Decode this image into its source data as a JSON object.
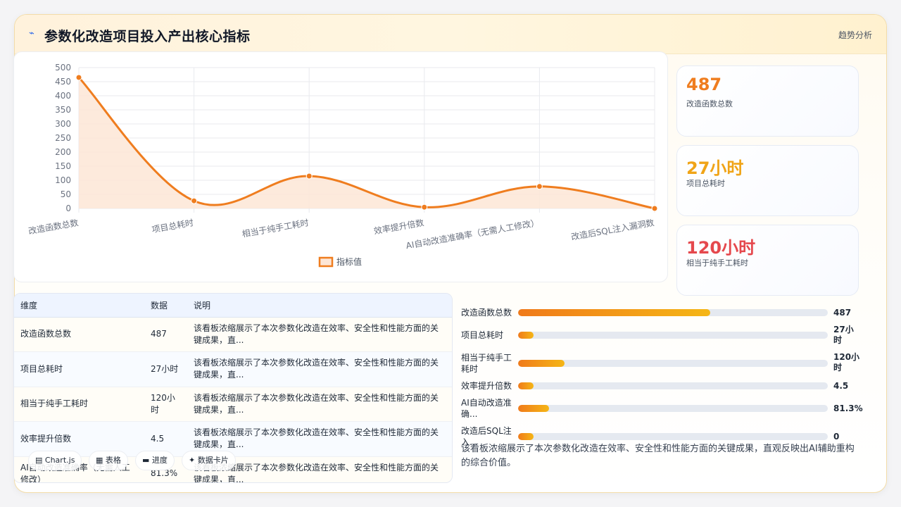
{
  "header": {
    "title": "参数化改造项目投入产出核心指标",
    "trend_label": "趋势分析",
    "icon": "lightning-icon"
  },
  "chart_data": {
    "type": "line",
    "categories": [
      "改造函数总数",
      "项目总耗时",
      "相当于纯手工耗时",
      "效率提升倍数",
      "AI自动改造准确率（无需人工修改）",
      "改造后SQL注入漏洞数"
    ],
    "series": [
      {
        "name": "指标值",
        "values": [
          465,
          27,
          115,
          4.5,
          78,
          0
        ]
      }
    ],
    "ylim": [
      0,
      500
    ],
    "yticks": [
      0,
      50,
      100,
      150,
      200,
      250,
      300,
      350,
      400,
      450,
      500
    ],
    "grid": true,
    "legend": "bottom",
    "line_color": "#ef7d1f",
    "fill_color": "#fde6d6"
  },
  "stats": [
    {
      "value": "487",
      "label": "改造函数总数",
      "color": "#ef7d1f"
    },
    {
      "value": "27小时",
      "label": "项目总耗时",
      "color": "#f0a417"
    },
    {
      "value": "120小时",
      "label": "相当于纯手工耗时",
      "color": "#e5484d"
    }
  ],
  "table": {
    "headers": [
      "维度",
      "数据",
      "说明"
    ],
    "rows": [
      {
        "dim": "改造函数总数",
        "val": "487",
        "desc": "该看板浓缩展示了本次参数化改造在效率、安全性和性能方面的关键成果，直..."
      },
      {
        "dim": "项目总耗时",
        "val": "27小时",
        "desc": "该看板浓缩展示了本次参数化改造在效率、安全性和性能方面的关键成果，直..."
      },
      {
        "dim": "相当于纯手工耗时",
        "val": "120小时",
        "desc": "该看板浓缩展示了本次参数化改造在效率、安全性和性能方面的关键成果，直..."
      },
      {
        "dim": "效率提升倍数",
        "val": "4.5",
        "desc": "该看板浓缩展示了本次参数化改造在效率、安全性和性能方面的关键成果，直..."
      },
      {
        "dim": "AI自动改造准确率（无需人工修改）",
        "val": "81.3%",
        "desc": "该看板浓缩展示了本次参数化改造在效率、安全性和性能方面的关键成果，直..."
      }
    ]
  },
  "progress": [
    {
      "label": "改造函数总数",
      "value": "487",
      "fraction": 0.62
    },
    {
      "label": "项目总耗时",
      "value": "27小时",
      "fraction": 0.05
    },
    {
      "label": "相当于纯手工耗时",
      "value": "120小时",
      "fraction": 0.15
    },
    {
      "label": "效率提升倍数",
      "value": "4.5",
      "fraction": 0.05
    },
    {
      "label": "AI自动改造准确...",
      "value": "81.3%",
      "fraction": 0.1
    },
    {
      "label": "改造后SQL注入...",
      "value": "0",
      "fraction": 0.05
    }
  ],
  "summary": "该看板浓缩展示了本次参数化改造在效率、安全性和性能方面的关键成果，直观反映出AI辅助重构的综合价值。",
  "view_tabs": [
    {
      "label": "Chart.js",
      "icon": "chart-icon"
    },
    {
      "label": "表格",
      "icon": "table-icon"
    },
    {
      "label": "进度",
      "icon": "progress-icon"
    },
    {
      "label": "数据卡片",
      "icon": "card-icon"
    }
  ]
}
